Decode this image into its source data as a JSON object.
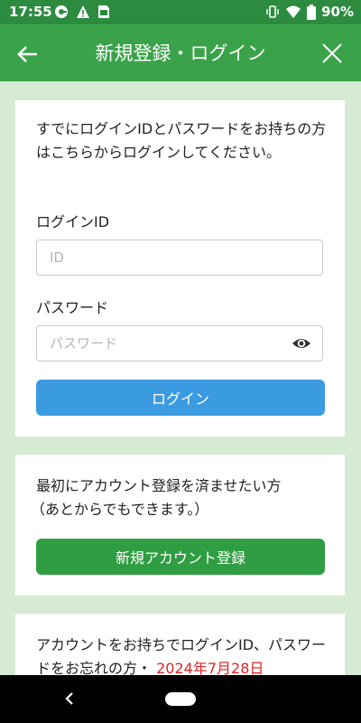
{
  "status_bar": {
    "time": "17:55",
    "battery": "90%",
    "icons_left": [
      "app-notification-icon",
      "warning-icon",
      "sim-card-icon"
    ],
    "icons_right": [
      "vibrate-icon",
      "wifi-icon",
      "battery-icon"
    ]
  },
  "app_bar": {
    "title": "新規登録・ログイン",
    "back_icon": "back-arrow-icon",
    "close_icon": "close-icon"
  },
  "login_card": {
    "description": "すでにログインIDとパスワードをお持ちの方はこちらからログインしてください。",
    "id_label": "ログインID",
    "id_placeholder": "ID",
    "id_value": "",
    "password_label": "パスワード",
    "password_placeholder": "パスワード",
    "password_value": "",
    "login_button": "ログイン"
  },
  "register_card": {
    "description_line1": "最初にアカウント登録を済ませたい方",
    "description_line2": "（あとからでもできます。）",
    "register_button": "新規アカウント登録"
  },
  "forgot_card": {
    "text": "アカウントをお持ちでログインID、パスワードをお忘れの方・",
    "date": "2024年7月28日"
  },
  "colors": {
    "status_bar": "#2c8b3f",
    "app_bar": "#3aa34a",
    "background": "#d6ebd3",
    "login_button": "#3b9be0",
    "register_button": "#2f9e42",
    "date_text": "#e02424"
  }
}
